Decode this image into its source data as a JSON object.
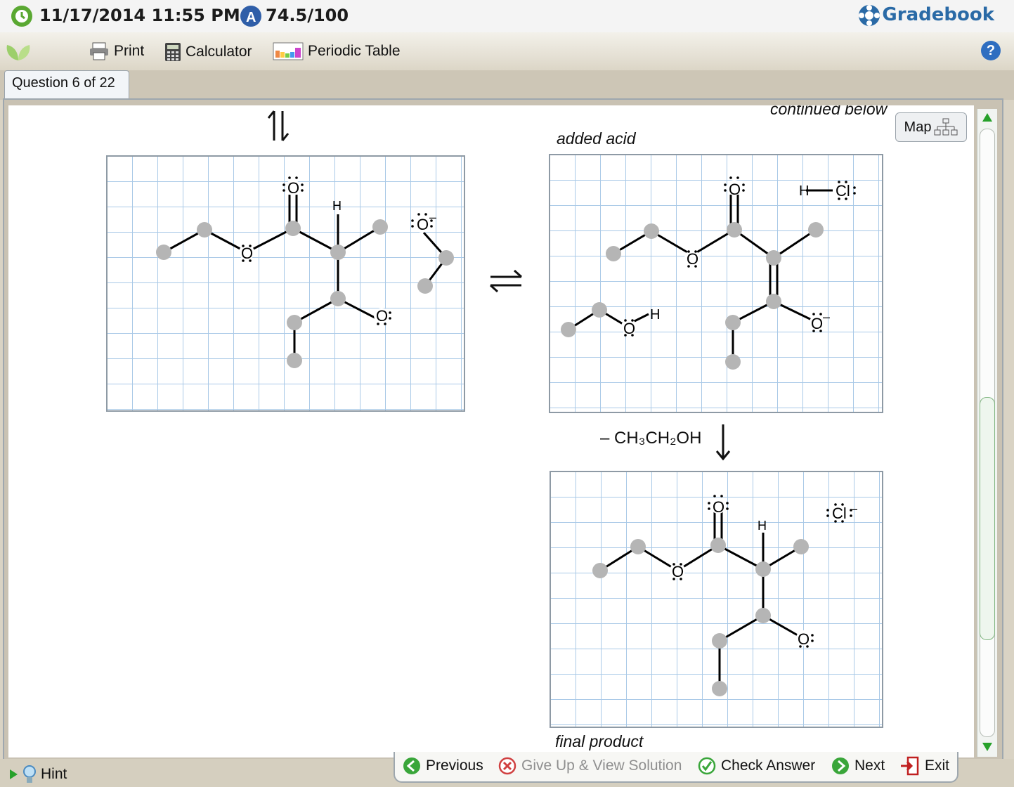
{
  "header": {
    "datetime": "11/17/2014 11:55 PM",
    "score": "74.5/100",
    "gradebook_label": "Gradebook"
  },
  "toolbar": {
    "print_label": "Print",
    "calculator_label": "Calculator",
    "periodic_table_label": "Periodic Table",
    "help_label": "?"
  },
  "tabs": [
    {
      "label": "Question 6 of 22"
    }
  ],
  "content": {
    "continued_text": "continued below",
    "map_label": "Map",
    "added_acid_label": "added acid",
    "final_product_label": "final product",
    "elimination_label": "– CH₃CH₂OH"
  },
  "molecules": {
    "o_label": "O",
    "h_label": "H",
    "cl_label": "Cl",
    "minus_label": "–"
  },
  "footer": {
    "hint_label": "Hint",
    "previous_label": "Previous",
    "give_up_label": "Give Up & View Solution",
    "check_answer_label": "Check Answer",
    "next_label": "Next",
    "exit_label": "Exit"
  },
  "colors": {
    "grid_line": "#a9c9e7",
    "node_gray": "#b5b5b5",
    "gradebook_blue": "#2a6aa6"
  }
}
